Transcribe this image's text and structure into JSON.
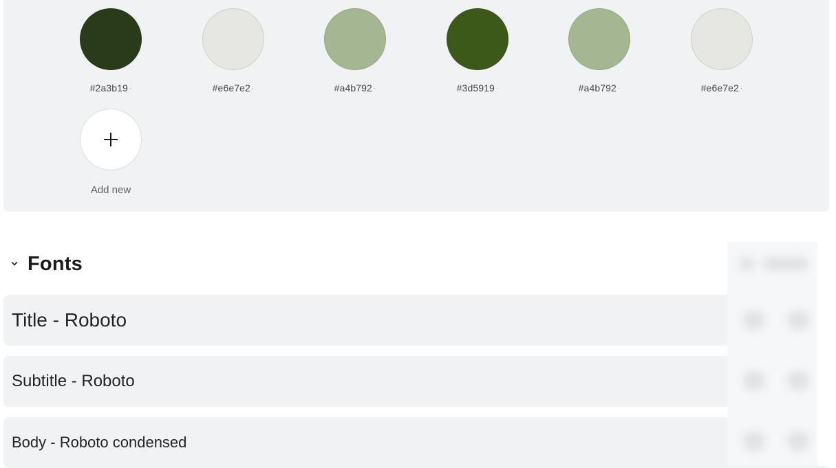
{
  "palette": {
    "swatches": [
      {
        "hex": "#2a3b19",
        "label": "#2a3b19",
        "marker": "·"
      },
      {
        "hex": "#e6e7e2",
        "label": "#e6e7e2",
        "marker": "·"
      },
      {
        "hex": "#a4b792",
        "label": "#a4b792",
        "marker": "·"
      },
      {
        "hex": "#3d5919",
        "label": "#3d5919",
        "marker": "·"
      },
      {
        "hex": "#a4b792",
        "label": "#a4b792",
        "marker": "·"
      },
      {
        "hex": "#e6e7e2",
        "label": "#e6e7e2",
        "marker": "·"
      }
    ],
    "add_new_label": "Add new",
    "add_icon": "plus-icon"
  },
  "fonts": {
    "section_title": "Fonts",
    "toggle_icon": "chevron-down-icon",
    "rows": [
      {
        "label": "Title - Roboto"
      },
      {
        "label": "Subtitle - Roboto"
      },
      {
        "label": "Body - Roboto condensed"
      }
    ]
  },
  "colors": {
    "panel_bg": "#f1f2f4",
    "text": "#1f2022"
  }
}
